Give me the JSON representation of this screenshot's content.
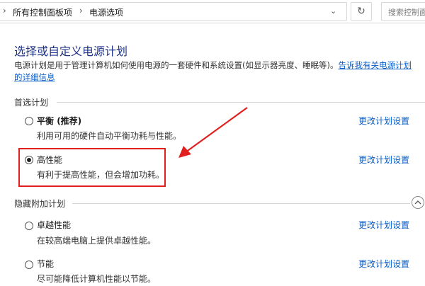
{
  "address_bar": {
    "crumbs": [
      "所有控制面板项",
      "电源选项"
    ],
    "separator": "›",
    "dropdown_glyph": "⌄",
    "refresh_glyph": "↻",
    "search_placeholder": "搜索控制面"
  },
  "page": {
    "title": "选择或自定义电源计划",
    "description": "电源计划是用于管理计算机如何使用电源的一套硬件和系统设置(如显示器亮度、睡眠等)。",
    "description_link": "告诉我有关电源计划的详细信息"
  },
  "preferred": {
    "label": "首选计划",
    "plans": [
      {
        "name": "平衡",
        "tag": " (推荐)",
        "description": "利用可用的硬件自动平衡功耗与性能。",
        "selected": false,
        "link": "更改计划设置"
      },
      {
        "name": "高性能",
        "tag": "",
        "description": "有利于提高性能，但会增加功耗。",
        "selected": true,
        "link": "更改计划设置"
      }
    ]
  },
  "hidden": {
    "label": "隐藏附加计划",
    "plans": [
      {
        "name": "卓越性能",
        "description": "在较高端电脑上提供卓越性能。",
        "selected": false,
        "link": "更改计划设置"
      },
      {
        "name": "节能",
        "description": "尽可能降低计算机性能以节能。",
        "selected": false,
        "link": "更改计划设置"
      }
    ]
  },
  "colors": {
    "title": "#1e3287",
    "link": "#0a5ec8",
    "annotation": "#e02020"
  },
  "icons": {
    "collapse": "chevron-up-icon",
    "arrow": "red-arrow-annotation"
  }
}
